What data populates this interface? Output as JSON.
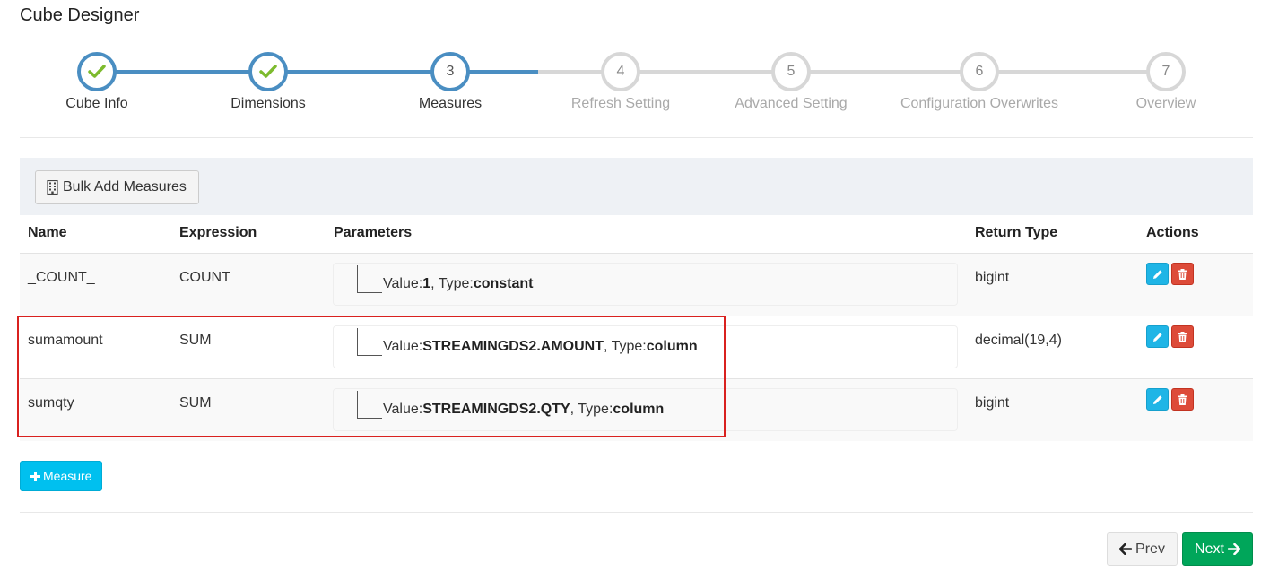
{
  "page": {
    "title": "Cube Designer"
  },
  "wizard": {
    "steps": [
      {
        "number": "1",
        "label": "Cube Info",
        "status": "done"
      },
      {
        "number": "2",
        "label": "Dimensions",
        "status": "done"
      },
      {
        "number": "3",
        "label": "Measures",
        "status": "active"
      },
      {
        "number": "4",
        "label": "Refresh Setting",
        "status": "todo"
      },
      {
        "number": "5",
        "label": "Advanced Setting",
        "status": "todo"
      },
      {
        "number": "6",
        "label": "Configuration Overwrites",
        "status": "todo"
      },
      {
        "number": "7",
        "label": "Overview",
        "status": "todo"
      }
    ],
    "colors": {
      "done": "#4a8ec2",
      "todo": "#d7d7d7",
      "check": "#7dbb2e"
    }
  },
  "toolbar": {
    "bulk_add_label": "Bulk Add Measures",
    "bulk_add_icon": "building-icon"
  },
  "table": {
    "headers": {
      "name": "Name",
      "expression": "Expression",
      "parameters": "Parameters",
      "return_type": "Return Type",
      "actions": "Actions"
    },
    "rows": [
      {
        "name": "_COUNT_",
        "expression": "COUNT",
        "value_label": "Value:",
        "value": "1",
        "type_label": ", Type:",
        "type": "constant",
        "return_type": "bigint"
      },
      {
        "name": "sumamount",
        "expression": "SUM",
        "value_label": "Value:",
        "value": "STREAMINGDS2.AMOUNT",
        "type_label": ", Type:",
        "type": "column",
        "return_type": "decimal(19,4)"
      },
      {
        "name": "sumqty",
        "expression": "SUM",
        "value_label": "Value:",
        "value": "STREAMINGDS2.QTY",
        "type_label": ", Type:",
        "type": "column",
        "return_type": "bigint"
      }
    ],
    "action_icons": {
      "edit": "pencil-icon",
      "delete": "trash-icon"
    }
  },
  "add_measure": {
    "icon": "plus-icon",
    "label": "Measure"
  },
  "nav": {
    "prev_label": "Prev",
    "next_label": "Next"
  },
  "colors": {
    "highlight": "#d9211f",
    "info": "#00c0ef",
    "success": "#00a65a",
    "danger": "#dd4b39"
  }
}
